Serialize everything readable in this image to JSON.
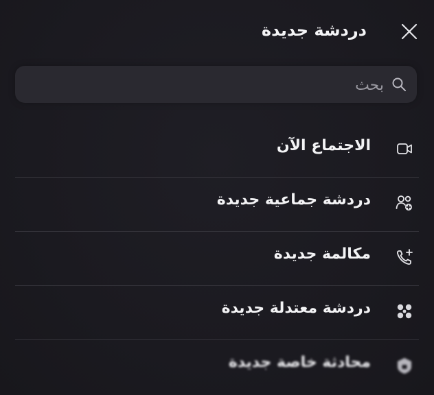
{
  "header": {
    "title": "دردشة جديدة",
    "close_icon": "close-icon"
  },
  "search": {
    "placeholder": "بحث",
    "value": "",
    "icon": "search-icon"
  },
  "menu": {
    "items": [
      {
        "label": "الاجتماع الآن",
        "icon": "video-meeting-icon"
      },
      {
        "label": "دردشة جماعية جديدة",
        "icon": "group-add-icon"
      },
      {
        "label": "مكالمة جديدة",
        "icon": "phone-add-icon"
      },
      {
        "label": "دردشة معتدلة جديدة",
        "icon": "moderated-chat-icon"
      },
      {
        "label": "محادثة خاصة جديدة",
        "icon": "private-lock-icon"
      }
    ]
  },
  "colors": {
    "background": "#1c1b21",
    "search_bg": "#2a2930",
    "text": "#f2f2f4",
    "divider": "#34333a"
  }
}
